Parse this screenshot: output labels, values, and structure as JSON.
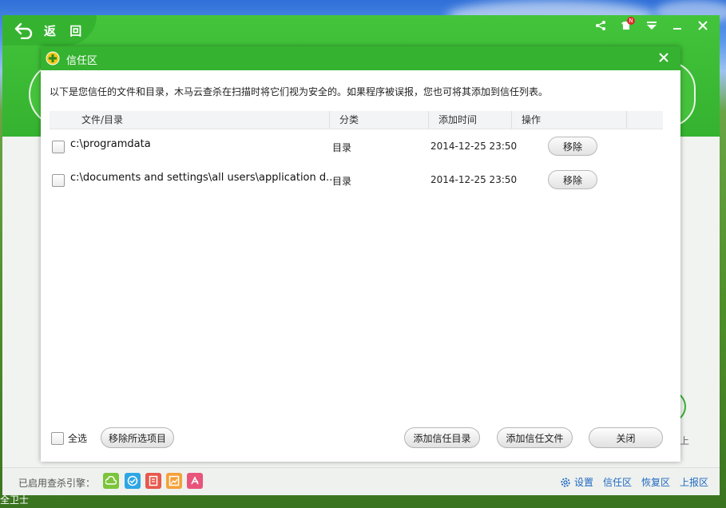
{
  "app": {
    "back_label": "返 回",
    "colors": {
      "brand_green": "#35b230",
      "link_blue": "#1f68c2"
    },
    "window_controls": [
      "share-icon",
      "skin-icon",
      "menu-icon",
      "minimize-icon",
      "close-icon"
    ],
    "skin_badge": "N"
  },
  "dialog": {
    "title": "信任区",
    "description": "以下是您信任的文件和目录，木马云查杀在扫描时将它们视为安全的。如果程序被误报，您也可将其添加到信任列表。",
    "columns": [
      "文件/目录",
      "分类",
      "添加时间",
      "操作"
    ],
    "rows": [
      {
        "path": "c:\\programdata",
        "type": "目录",
        "time": "2014-12-25 23:50",
        "action": "移除",
        "checked": false
      },
      {
        "path": "c:\\documents and settings\\all users\\application d...",
        "type": "目录",
        "time": "2014-12-25 23:50",
        "action": "移除",
        "checked": false
      }
    ],
    "select_all_label": "全选",
    "remove_selected_label": "移除所选项目",
    "add_dir_label": "添加信任目录",
    "add_file_label": "添加信任文件",
    "close_label": "关闭"
  },
  "footer": {
    "engines_label": "已启用查杀引擎：",
    "engines": [
      {
        "icon": "cloud-engine-icon",
        "color": "#7cc43a"
      },
      {
        "icon": "check-engine-icon",
        "color": "#2ea6e4"
      },
      {
        "icon": "qvm-engine-icon",
        "color": "#e8584c"
      },
      {
        "icon": "image-engine-icon",
        "color": "#f5a13a"
      },
      {
        "icon": "avira-engine-icon",
        "color": "#e8547a"
      }
    ],
    "links": {
      "settings": "设置",
      "trust": "信任区",
      "restore": "恢复区",
      "report": "上报区"
    }
  },
  "desktop": {
    "caption": "全卫士",
    "bg_mark": "上"
  }
}
